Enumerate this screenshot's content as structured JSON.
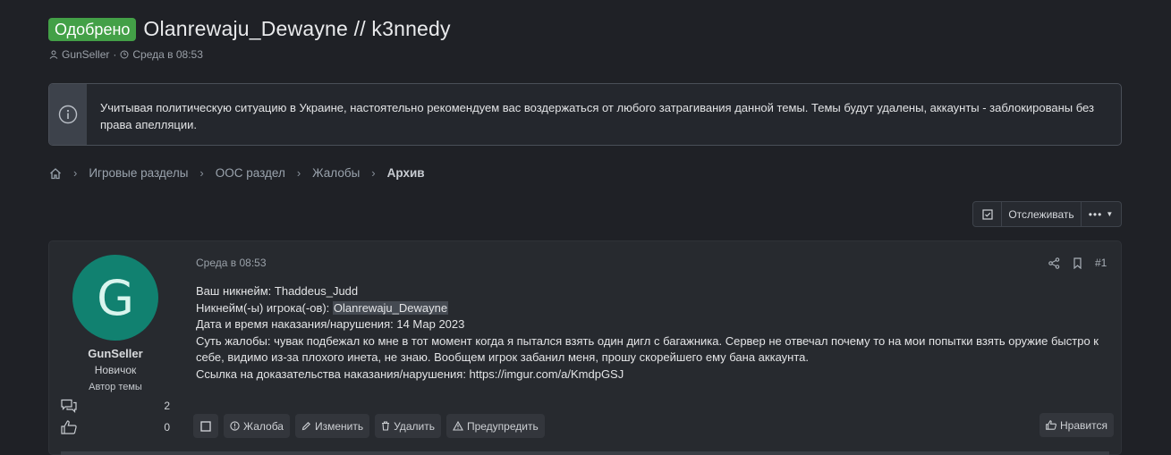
{
  "thread": {
    "status_badge": "Одобрено",
    "title": "Olanrewaju_Dewayne // k3nnedy",
    "author": "GunSeller",
    "separator": "·",
    "time": "Среда в 08:53"
  },
  "notice": {
    "text": "Учитывая политическую ситуацию в Украине, настоятельно рекомендуем вас воздержаться от любого затрагивания данной темы. Темы будут удалены, аккаунты - заблокированы без права апелляции."
  },
  "breadcrumb": {
    "items": [
      "Игровые разделы",
      "ООС раздел",
      "Жалобы"
    ],
    "current": "Архив"
  },
  "watch": {
    "label": "Отслеживать",
    "more": "•••"
  },
  "post": {
    "avatar_letter": "G",
    "username": "GunSeller",
    "rank": "Новичок",
    "author_tag": "Автор темы",
    "messages_count": "2",
    "reactions_count": "0",
    "date": "Среда в 08:53",
    "number": "#1",
    "lines": [
      "Ваш никнейм: Thaddeus_Judd",
      "Дата и время наказания/нарушения: 14 Мар 2023",
      "Суть жалобы: чувак подбежал ко мне в тот момент когда я пытался взять один дигл с багажника. Сервер не отвечал почему то на мои попытки взять оружие быстро к себе, видимо из-за плохого инета, не знаю. Вообщем игрок забанил меня, прошу скорейшего ему бана аккаунта.",
      "Ссылка на доказательства наказания/нарушения: https://imgur.com/a/KmdpGSJ"
    ],
    "nick_label": "Никнейм(-ы) игрока(-ов): ",
    "nick_value": "Olanrewaju_Dewayne"
  },
  "actions": {
    "report": "Жалоба",
    "edit": "Изменить",
    "delete": "Удалить",
    "warn": "Предупредить",
    "like": "Нравится"
  },
  "colors": {
    "background": "#1f2126",
    "badge": "#43a047",
    "avatar": "#118170",
    "card": "#272a2f"
  }
}
